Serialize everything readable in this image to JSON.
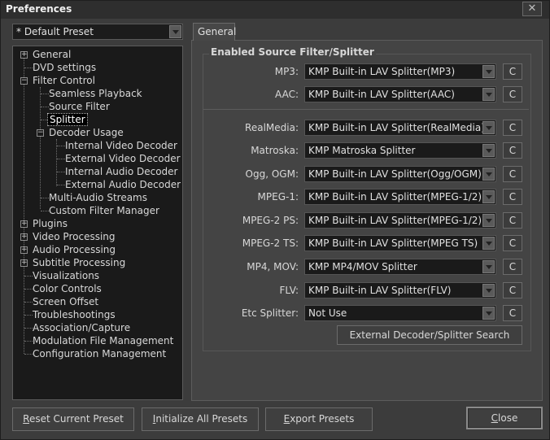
{
  "window": {
    "title": "Preferences",
    "close_glyph": "✕"
  },
  "preset": {
    "selected": "* Default Preset"
  },
  "tree": {
    "general": "General",
    "dvd": "DVD settings",
    "filter_control": "Filter Control",
    "seamless": "Seamless Playback",
    "source_filter": "Source Filter",
    "splitter": "Splitter",
    "decoder_usage": "Decoder Usage",
    "internal_video": "Internal Video Decoder",
    "external_video": "External Video Decoder",
    "internal_audio": "Internal Audio Decoder",
    "external_audio": "External Audio Decoder",
    "multi_audio": "Multi-Audio Streams",
    "custom_filter": "Custom Filter Manager",
    "plugins": "Plugins",
    "video_processing": "Video Processing",
    "audio_processing": "Audio Processing",
    "subtitle_processing": "Subtitle Processing",
    "visualizations": "Visualizations",
    "color_controls": "Color Controls",
    "screen_offset": "Screen Offset",
    "troubleshootings": "Troubleshootings",
    "association": "Association/Capture",
    "modulation": "Modulation File Management",
    "configuration": "Configuration Management",
    "plus": "+",
    "minus": "−"
  },
  "tab": {
    "label": "General"
  },
  "group": {
    "title": "Enabled Source Filter/Splitter"
  },
  "rows": [
    {
      "label": "MP3:",
      "value": "KMP Built-in LAV Splitter(MP3)",
      "c": "C"
    },
    {
      "label": "AAC:",
      "value": "KMP Built-in LAV Splitter(AAC)",
      "c": "C"
    },
    {
      "label": "RealMedia:",
      "value": "KMP Built-in LAV Splitter(RealMedia)",
      "c": "C"
    },
    {
      "label": "Matroska:",
      "value": "KMP Matroska Splitter",
      "c": "C"
    },
    {
      "label": "Ogg, OGM:",
      "value": "KMP Built-in LAV Splitter(Ogg/OGM)",
      "c": "C"
    },
    {
      "label": "MPEG-1:",
      "value": "KMP Built-in LAV Splitter(MPEG-1/2)",
      "c": "C"
    },
    {
      "label": "MPEG-2 PS:",
      "value": "KMP Built-in LAV Splitter(MPEG-1/2)",
      "c": "C"
    },
    {
      "label": "MPEG-2 TS:",
      "value": "KMP Built-in LAV Splitter(MPEG TS)",
      "c": "C"
    },
    {
      "label": "MP4, MOV:",
      "value": "KMP MP4/MOV Splitter",
      "c": "C"
    },
    {
      "label": "FLV:",
      "value": "KMP Built-in LAV Splitter(FLV)",
      "c": "C"
    },
    {
      "label": "Etc Splitter:",
      "value": "Not Use",
      "c": "C"
    }
  ],
  "buttons": {
    "external_search": "External Decoder/Splitter Search",
    "reset_first": "R",
    "reset_rest": "eset Current Preset",
    "init_first": "I",
    "init_rest": "nitialize All Presets",
    "export_first": "E",
    "export_rest": "xport Presets",
    "close_first": "C",
    "close_rest": "lose"
  }
}
